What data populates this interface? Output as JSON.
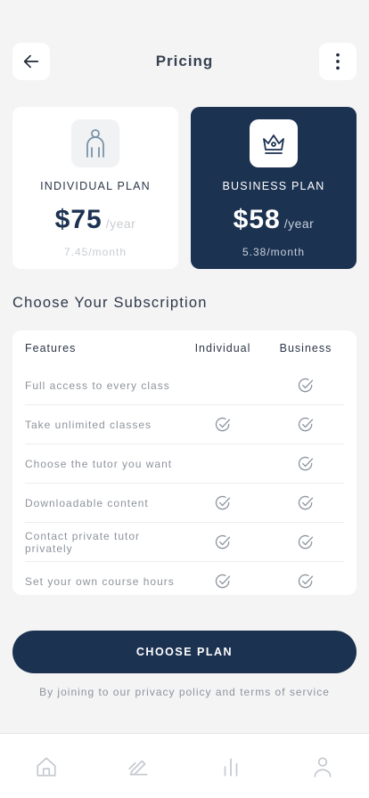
{
  "header": {
    "title": "Pricing",
    "back_icon": "arrow-left-icon",
    "menu_icon": "more-vertical-icon"
  },
  "plans": [
    {
      "name": "INDIVIDUAL PLAN",
      "price": "$75",
      "period": "/year",
      "monthly": "7.45/month",
      "icon": "person-icon",
      "selected": false
    },
    {
      "name": "BUSINESS PLAN",
      "price": "$58",
      "period": "/year",
      "monthly": "5.38/month",
      "icon": "crown-icon",
      "selected": true
    }
  ],
  "section_title": "Choose Your Subscription",
  "features_table": {
    "headers": [
      "Features",
      "Individual",
      "Business"
    ],
    "rows": [
      {
        "feature": "Full access to every class",
        "individual": false,
        "business": true
      },
      {
        "feature": "Take unlimited classes",
        "individual": true,
        "business": true
      },
      {
        "feature": "Choose the tutor you want",
        "individual": false,
        "business": true
      },
      {
        "feature": "Downloadable content",
        "individual": true,
        "business": true
      },
      {
        "feature": "Contact private tutor privately",
        "individual": true,
        "business": true
      },
      {
        "feature": "Set your own course hours",
        "individual": true,
        "business": true
      }
    ]
  },
  "cta_label": "CHOOSE PLAN",
  "terms_text": "By joining to our privacy policy and terms of service",
  "tabbar": [
    "home-icon",
    "edit-icon",
    "chart-icon",
    "profile-icon"
  ],
  "colors": {
    "primary": "#1c3251",
    "background": "#f4f4f5",
    "check": "#8f96a1"
  }
}
